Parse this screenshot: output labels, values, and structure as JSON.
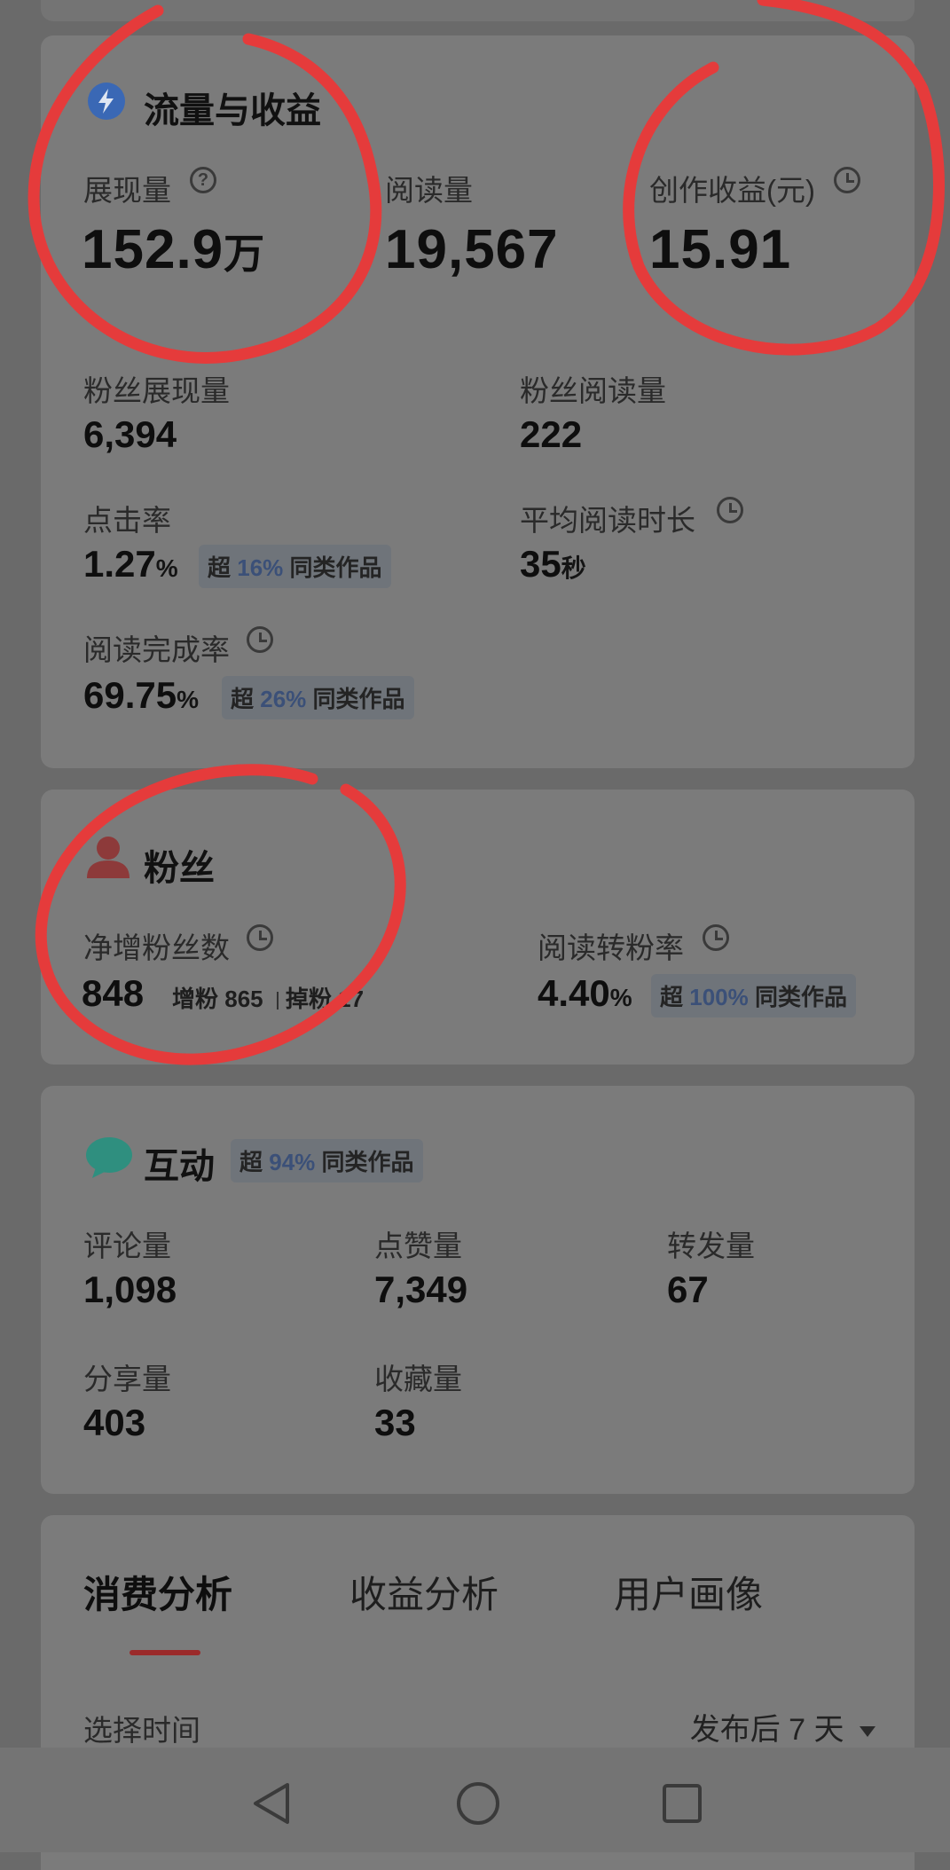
{
  "traffic": {
    "title": "流量与收益",
    "impressions": {
      "label": "展现量",
      "value": "152.9",
      "unit": "万"
    },
    "reads": {
      "label": "阅读量",
      "value": "19,567"
    },
    "earnings": {
      "label": "创作收益(元)",
      "value": "15.91"
    },
    "fan_impressions": {
      "label": "粉丝展现量",
      "value": "6,394"
    },
    "fan_reads": {
      "label": "粉丝阅读量",
      "value": "222"
    },
    "ctr": {
      "label": "点击率",
      "value": "1.27",
      "unit": "%",
      "badge_prefix": "超",
      "badge_pct": "16%",
      "badge_suffix": "同类作品"
    },
    "avg_read_time": {
      "label": "平均阅读时长",
      "value": "35",
      "unit": "秒"
    },
    "completion": {
      "label": "阅读完成率",
      "value": "69.75",
      "unit": "%",
      "badge_prefix": "超",
      "badge_pct": "26%",
      "badge_suffix": "同类作品"
    }
  },
  "fans": {
    "title": "粉丝",
    "net": {
      "label": "净增粉丝数",
      "value": "848",
      "gain_label": "增粉",
      "gain_value": "865",
      "loss_label": "掉粉",
      "loss_value": "17"
    },
    "conversion": {
      "label": "阅读转粉率",
      "value": "4.40",
      "unit": "%",
      "badge_prefix": "超",
      "badge_pct": "100%",
      "badge_suffix": "同类作品"
    }
  },
  "interaction": {
    "title": "互动",
    "badge_prefix": "超",
    "badge_pct": "94%",
    "badge_suffix": "同类作品",
    "comments": {
      "label": "评论量",
      "value": "1,098"
    },
    "likes": {
      "label": "点赞量",
      "value": "7,349"
    },
    "reposts": {
      "label": "转发量",
      "value": "67"
    },
    "shares": {
      "label": "分享量",
      "value": "403"
    },
    "favorites": {
      "label": "收藏量",
      "value": "33"
    }
  },
  "analysis": {
    "tabs": [
      "消费分析",
      "收益分析",
      "用户画像"
    ],
    "active_tab": 0,
    "time_label": "选择时间",
    "time_value": "发布后 7 天"
  },
  "colors": {
    "accent_red": "#e53b3b",
    "badge_blue": "#3b5078",
    "tab_underline": "#9b2a2a",
    "fans_icon": "#8d3a3a",
    "chat_icon": "#2f8f7f",
    "bolt_icon": "#3a68b5"
  },
  "icons": [
    "lightning-icon",
    "help-icon",
    "clock-icon",
    "user-icon",
    "chat-icon",
    "caret-down-icon",
    "back-icon",
    "home-icon",
    "recents-icon"
  ]
}
